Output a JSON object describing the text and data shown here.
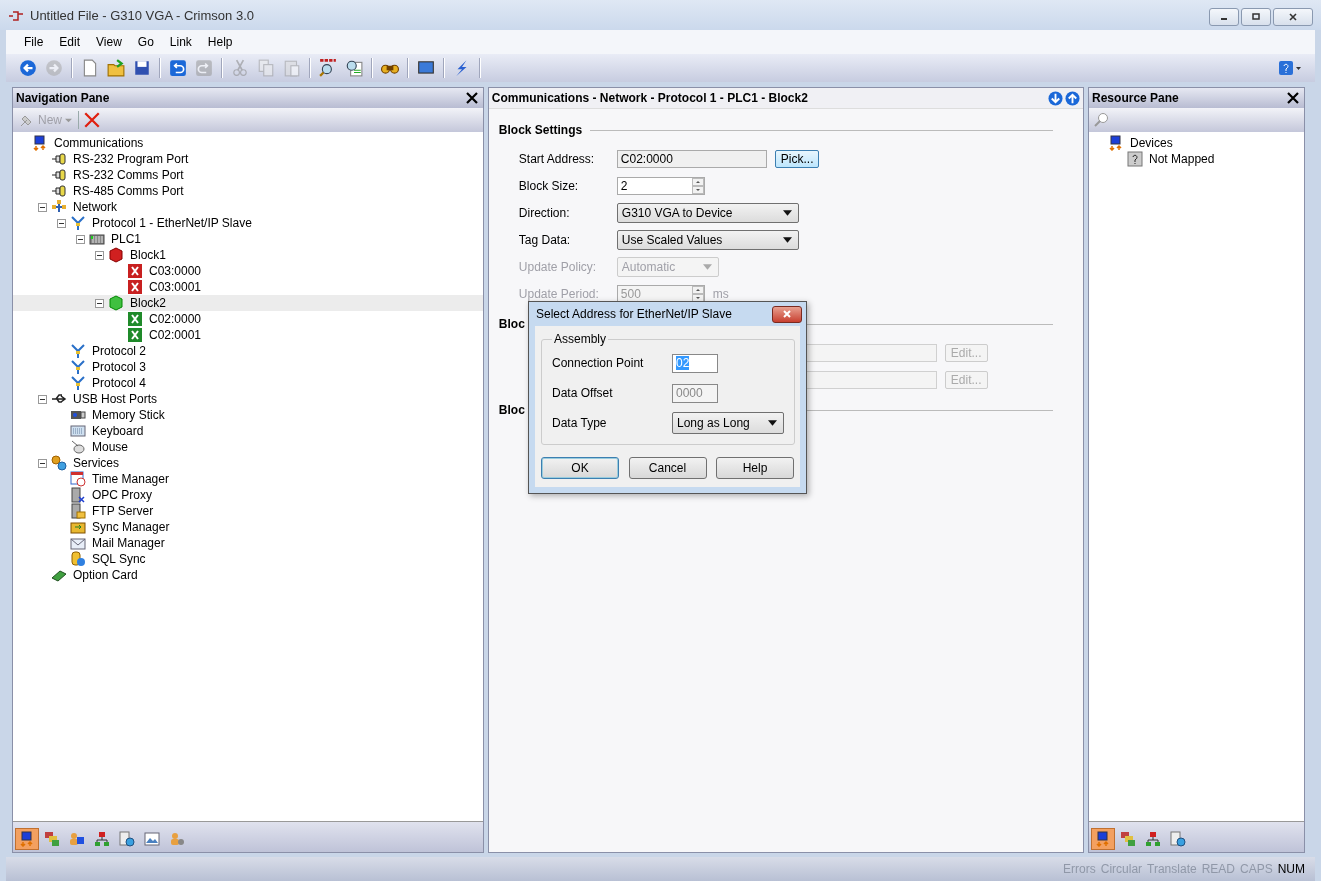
{
  "window": {
    "title": "Untitled File - G310 VGA - Crimson 3.0"
  },
  "menu": [
    "File",
    "Edit",
    "View",
    "Go",
    "Link",
    "Help"
  ],
  "toolbar": [
    {
      "kind": "back",
      "disabled": false
    },
    {
      "kind": "forward",
      "disabled": true
    },
    {
      "kind": "separator"
    },
    {
      "kind": "new",
      "disabled": false
    },
    {
      "kind": "open",
      "disabled": false
    },
    {
      "kind": "save",
      "disabled": false
    },
    {
      "kind": "separator"
    },
    {
      "kind": "undo",
      "disabled": false
    },
    {
      "kind": "redo",
      "disabled": true
    },
    {
      "kind": "separator"
    },
    {
      "kind": "cut",
      "disabled": true
    },
    {
      "kind": "copy",
      "disabled": true
    },
    {
      "kind": "paste",
      "disabled": true
    },
    {
      "kind": "separator"
    },
    {
      "kind": "find-all",
      "disabled": false
    },
    {
      "kind": "find",
      "disabled": false
    },
    {
      "kind": "separator"
    },
    {
      "kind": "binoculars",
      "disabled": false
    },
    {
      "kind": "separator"
    },
    {
      "kind": "monitor",
      "disabled": false
    },
    {
      "kind": "separator"
    },
    {
      "kind": "lightning",
      "disabled": false
    },
    {
      "kind": "separator"
    }
  ],
  "navigation_pane": {
    "title": "Navigation Pane",
    "new_button": {
      "label": "New",
      "disabled": true
    },
    "tree": [
      {
        "label": "Communications",
        "kind": "comm",
        "selected": false,
        "children": [
          {
            "label": "RS-232 Program Port",
            "kind": "port",
            "selected": false
          },
          {
            "label": "RS-232 Comms Port",
            "kind": "port",
            "selected": false
          },
          {
            "label": "RS-485 Comms Port",
            "kind": "port",
            "selected": false
          },
          {
            "label": "Network",
            "kind": "network",
            "selected": false,
            "expanded": true,
            "children": [
              {
                "label": "Protocol 1 - EtherNet/IP Slave",
                "kind": "protocol",
                "selected": false,
                "expanded": true,
                "children": [
                  {
                    "label": "PLC1",
                    "kind": "plc",
                    "selected": false,
                    "expanded": true,
                    "children": [
                      {
                        "label": "Block1",
                        "kind": "block-error",
                        "selected": false,
                        "expanded": true,
                        "children": [
                          {
                            "label": "C03:0000",
                            "kind": "tag-error",
                            "selected": false
                          },
                          {
                            "label": "C03:0001",
                            "kind": "tag-error",
                            "selected": false
                          }
                        ]
                      },
                      {
                        "label": "Block2",
                        "kind": "block-ok",
                        "selected": true,
                        "expanded": true,
                        "children": [
                          {
                            "label": "C02:0000",
                            "kind": "tag-ok",
                            "selected": false
                          },
                          {
                            "label": "C02:0001",
                            "kind": "tag-ok",
                            "selected": false
                          }
                        ]
                      }
                    ]
                  }
                ]
              },
              {
                "label": "Protocol 2",
                "kind": "protocol",
                "selected": false
              },
              {
                "label": "Protocol 3",
                "kind": "protocol",
                "selected": false
              },
              {
                "label": "Protocol 4",
                "kind": "protocol",
                "selected": false
              }
            ]
          },
          {
            "label": "USB Host Ports",
            "kind": "usb",
            "selected": false,
            "expanded": true,
            "children": [
              {
                "label": "Memory Stick",
                "kind": "memory",
                "selected": false
              },
              {
                "label": "Keyboard",
                "kind": "keyboard",
                "selected": false
              },
              {
                "label": "Mouse",
                "kind": "mouse",
                "selected": false
              }
            ]
          },
          {
            "label": "Services",
            "kind": "services",
            "selected": false,
            "expanded": true,
            "children": [
              {
                "label": "Time Manager",
                "kind": "calendar",
                "selected": false
              },
              {
                "label": "OPC Proxy",
                "kind": "server",
                "selected": false
              },
              {
                "label": "FTP Server",
                "kind": "server-folder",
                "selected": false
              },
              {
                "label": "Sync Manager",
                "kind": "sync",
                "selected": false
              },
              {
                "label": "Mail Manager",
                "kind": "mail",
                "selected": false
              },
              {
                "label": "SQL Sync",
                "kind": "database",
                "selected": false
              }
            ]
          },
          {
            "label": "Option Card",
            "kind": "card",
            "selected": false
          }
        ]
      }
    ],
    "footer_tabs": [
      {
        "kind": "comm",
        "selected": true
      },
      {
        "kind": "tags",
        "selected": false
      },
      {
        "kind": "users",
        "selected": false
      },
      {
        "kind": "hierarchy",
        "selected": false
      },
      {
        "kind": "globe",
        "selected": false
      },
      {
        "kind": "picture",
        "selected": false
      },
      {
        "kind": "person-gear",
        "selected": false
      }
    ]
  },
  "editor": {
    "breadcrumb": "Communications - Network - Protocol 1 - PLC1 - Block2",
    "sections": [
      {
        "title": "Block Settings",
        "rows": [
          {
            "label": "Start Address:",
            "kind": "text",
            "value": "C02:0000",
            "button": "Pick...",
            "disabled": false
          },
          {
            "label": "Block Size:",
            "kind": "spin",
            "value": "2",
            "disabled": false
          },
          {
            "label": "Direction:",
            "kind": "select",
            "value": "G310 VGA to Device",
            "disabled": false
          },
          {
            "label": "Tag Data:",
            "kind": "select",
            "value": "Use Scaled Values",
            "disabled": false
          },
          {
            "label": "Update Policy:",
            "kind": "select",
            "value": "Automatic",
            "disabled": true
          },
          {
            "label": "Update Period:",
            "kind": "spin",
            "value": "500",
            "unit": "ms",
            "disabled": true
          }
        ]
      },
      {
        "title": "Bloc",
        "rows": [
          {
            "kind": "text",
            "button": "Edit...",
            "disabled": true
          },
          {
            "kind": "text",
            "button": "Edit...",
            "disabled": true
          }
        ]
      },
      {
        "title": "Bloc"
      }
    ]
  },
  "dialog": {
    "title": "Select Address for EtherNet/IP Slave",
    "group": "Assembly",
    "fields": [
      {
        "label": "Connection Point",
        "kind": "text",
        "value": "02",
        "highlighted": true,
        "disabled": false
      },
      {
        "label": "Data Offset",
        "kind": "text",
        "value": "0000",
        "disabled": true
      },
      {
        "label": "Data Type",
        "kind": "select",
        "value": "Long as Long",
        "disabled": false
      }
    ],
    "buttons": [
      {
        "label": "OK",
        "default": true
      },
      {
        "label": "Cancel",
        "default": false
      },
      {
        "label": "Help",
        "default": false
      }
    ]
  },
  "resource_pane": {
    "title": "Resource Pane",
    "tree": [
      {
        "label": "Devices",
        "kind": "comm",
        "selected": false,
        "children": [
          {
            "label": "Not Mapped",
            "kind": "unknown",
            "selected": false
          }
        ]
      }
    ],
    "footer_tabs": [
      {
        "kind": "comm",
        "selected": true
      },
      {
        "kind": "tags",
        "selected": false
      },
      {
        "kind": "hierarchy",
        "selected": false
      },
      {
        "kind": "globe",
        "selected": false
      }
    ]
  },
  "status_bar": [
    {
      "label": "Errors",
      "on": false
    },
    {
      "label": "Circular",
      "on": false
    },
    {
      "label": "Translate",
      "on": false
    },
    {
      "label": "READ",
      "on": false
    },
    {
      "label": "CAPS",
      "on": false
    },
    {
      "label": "NUM",
      "on": true
    }
  ]
}
